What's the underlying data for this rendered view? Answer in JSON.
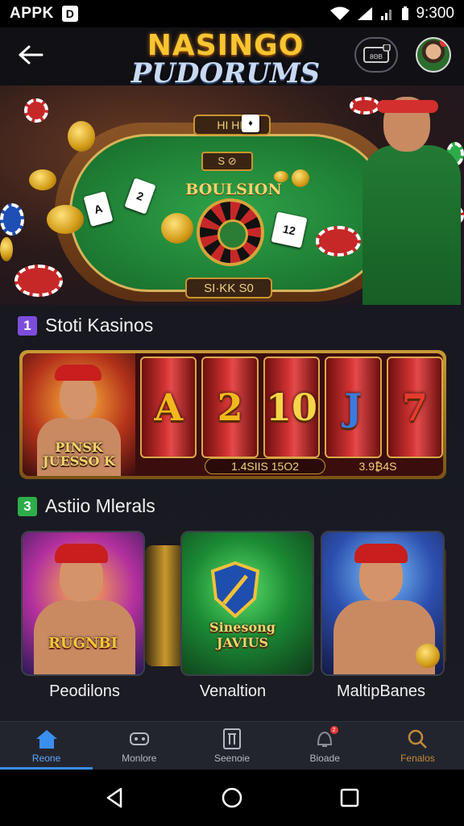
{
  "status_bar": {
    "app_label": "APPK",
    "app_badge": "D",
    "time": "9:300"
  },
  "header": {
    "brand_line1": "NASINGO",
    "brand_line2": "PUDORUMS",
    "wallet_label": "8ΘB"
  },
  "hero": {
    "top_sign": "ΗΙ ΗΚ",
    "mid_sign": "S ⊘",
    "felt_title": "BOULSION",
    "bottom_sign": "SI·ΚΚ S0",
    "cards": [
      "A",
      "2",
      "♦",
      "12"
    ]
  },
  "sections": {
    "slots": {
      "number": "1",
      "title": "Stoti Kasinos",
      "portrait_logo": "PINSK JUESSO K",
      "reels": [
        "A",
        "2",
        "10",
        "J",
        "7"
      ],
      "readout_left": "1.4SIIS 15O2",
      "readout_right": "3.9₿4S"
    },
    "featured": {
      "number": "3",
      "title": "Astiio Mlerals",
      "games": [
        {
          "logo": "RUGNBI",
          "label": "Peodilons"
        },
        {
          "logo": "Sinesong JAVIUS",
          "label": "Venaltion"
        },
        {
          "logo": "",
          "label": "MaltipBanes"
        }
      ]
    }
  },
  "bottom_nav": {
    "items": [
      {
        "label": "Reone",
        "icon": "home-icon",
        "active": true
      },
      {
        "label": "Monlore",
        "icon": "gamepad-icon",
        "active": false
      },
      {
        "label": "Seenoie",
        "icon": "cards-icon",
        "active": false
      },
      {
        "label": "Bioade",
        "icon": "bell-icon",
        "active": false,
        "badge": "2"
      },
      {
        "label": "Fenalos",
        "icon": "search-icon",
        "active": false
      }
    ]
  },
  "colors": {
    "accent": "#3a8ef0",
    "gold": "#f7c531",
    "section_1_badge": "#7c4ddc",
    "section_3_badge": "#2eac4a",
    "nav_bg": "#23252e"
  }
}
